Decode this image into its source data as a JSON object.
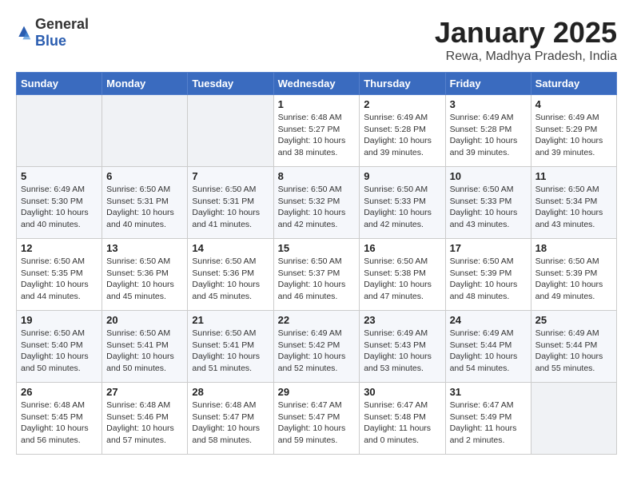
{
  "app": {
    "logo_general": "General",
    "logo_blue": "Blue"
  },
  "header": {
    "title": "January 2025",
    "subtitle": "Rewa, Madhya Pradesh, India"
  },
  "days_of_week": [
    "Sunday",
    "Monday",
    "Tuesday",
    "Wednesday",
    "Thursday",
    "Friday",
    "Saturday"
  ],
  "weeks": [
    [
      {
        "day": "",
        "content": ""
      },
      {
        "day": "",
        "content": ""
      },
      {
        "day": "",
        "content": ""
      },
      {
        "day": "1",
        "content": "Sunrise: 6:48 AM\nSunset: 5:27 PM\nDaylight: 10 hours\nand 38 minutes."
      },
      {
        "day": "2",
        "content": "Sunrise: 6:49 AM\nSunset: 5:28 PM\nDaylight: 10 hours\nand 39 minutes."
      },
      {
        "day": "3",
        "content": "Sunrise: 6:49 AM\nSunset: 5:28 PM\nDaylight: 10 hours\nand 39 minutes."
      },
      {
        "day": "4",
        "content": "Sunrise: 6:49 AM\nSunset: 5:29 PM\nDaylight: 10 hours\nand 39 minutes."
      }
    ],
    [
      {
        "day": "5",
        "content": "Sunrise: 6:49 AM\nSunset: 5:30 PM\nDaylight: 10 hours\nand 40 minutes."
      },
      {
        "day": "6",
        "content": "Sunrise: 6:50 AM\nSunset: 5:31 PM\nDaylight: 10 hours\nand 40 minutes."
      },
      {
        "day": "7",
        "content": "Sunrise: 6:50 AM\nSunset: 5:31 PM\nDaylight: 10 hours\nand 41 minutes."
      },
      {
        "day": "8",
        "content": "Sunrise: 6:50 AM\nSunset: 5:32 PM\nDaylight: 10 hours\nand 42 minutes."
      },
      {
        "day": "9",
        "content": "Sunrise: 6:50 AM\nSunset: 5:33 PM\nDaylight: 10 hours\nand 42 minutes."
      },
      {
        "day": "10",
        "content": "Sunrise: 6:50 AM\nSunset: 5:33 PM\nDaylight: 10 hours\nand 43 minutes."
      },
      {
        "day": "11",
        "content": "Sunrise: 6:50 AM\nSunset: 5:34 PM\nDaylight: 10 hours\nand 43 minutes."
      }
    ],
    [
      {
        "day": "12",
        "content": "Sunrise: 6:50 AM\nSunset: 5:35 PM\nDaylight: 10 hours\nand 44 minutes."
      },
      {
        "day": "13",
        "content": "Sunrise: 6:50 AM\nSunset: 5:36 PM\nDaylight: 10 hours\nand 45 minutes."
      },
      {
        "day": "14",
        "content": "Sunrise: 6:50 AM\nSunset: 5:36 PM\nDaylight: 10 hours\nand 45 minutes."
      },
      {
        "day": "15",
        "content": "Sunrise: 6:50 AM\nSunset: 5:37 PM\nDaylight: 10 hours\nand 46 minutes."
      },
      {
        "day": "16",
        "content": "Sunrise: 6:50 AM\nSunset: 5:38 PM\nDaylight: 10 hours\nand 47 minutes."
      },
      {
        "day": "17",
        "content": "Sunrise: 6:50 AM\nSunset: 5:39 PM\nDaylight: 10 hours\nand 48 minutes."
      },
      {
        "day": "18",
        "content": "Sunrise: 6:50 AM\nSunset: 5:39 PM\nDaylight: 10 hours\nand 49 minutes."
      }
    ],
    [
      {
        "day": "19",
        "content": "Sunrise: 6:50 AM\nSunset: 5:40 PM\nDaylight: 10 hours\nand 50 minutes."
      },
      {
        "day": "20",
        "content": "Sunrise: 6:50 AM\nSunset: 5:41 PM\nDaylight: 10 hours\nand 50 minutes."
      },
      {
        "day": "21",
        "content": "Sunrise: 6:50 AM\nSunset: 5:41 PM\nDaylight: 10 hours\nand 51 minutes."
      },
      {
        "day": "22",
        "content": "Sunrise: 6:49 AM\nSunset: 5:42 PM\nDaylight: 10 hours\nand 52 minutes."
      },
      {
        "day": "23",
        "content": "Sunrise: 6:49 AM\nSunset: 5:43 PM\nDaylight: 10 hours\nand 53 minutes."
      },
      {
        "day": "24",
        "content": "Sunrise: 6:49 AM\nSunset: 5:44 PM\nDaylight: 10 hours\nand 54 minutes."
      },
      {
        "day": "25",
        "content": "Sunrise: 6:49 AM\nSunset: 5:44 PM\nDaylight: 10 hours\nand 55 minutes."
      }
    ],
    [
      {
        "day": "26",
        "content": "Sunrise: 6:48 AM\nSunset: 5:45 PM\nDaylight: 10 hours\nand 56 minutes."
      },
      {
        "day": "27",
        "content": "Sunrise: 6:48 AM\nSunset: 5:46 PM\nDaylight: 10 hours\nand 57 minutes."
      },
      {
        "day": "28",
        "content": "Sunrise: 6:48 AM\nSunset: 5:47 PM\nDaylight: 10 hours\nand 58 minutes."
      },
      {
        "day": "29",
        "content": "Sunrise: 6:47 AM\nSunset: 5:47 PM\nDaylight: 10 hours\nand 59 minutes."
      },
      {
        "day": "30",
        "content": "Sunrise: 6:47 AM\nSunset: 5:48 PM\nDaylight: 11 hours\nand 0 minutes."
      },
      {
        "day": "31",
        "content": "Sunrise: 6:47 AM\nSunset: 5:49 PM\nDaylight: 11 hours\nand 2 minutes."
      },
      {
        "day": "",
        "content": ""
      }
    ]
  ]
}
